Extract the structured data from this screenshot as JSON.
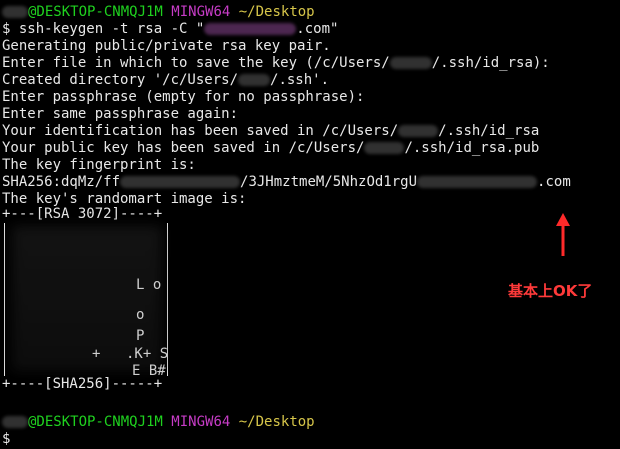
{
  "prompt": {
    "user_host": "@DESKTOP-CNMQJ1M",
    "shell": "MINGW64",
    "path": "~/Desktop"
  },
  "lines": {
    "cmd_pre": "$ ssh-keygen -t rsa -C \"",
    "cmd_post": ".com\"",
    "l2": "Generating public/private rsa key pair.",
    "l3_pre": "Enter file in which to save the key (/c/Users/",
    "l3_post": "/.ssh/id_rsa):",
    "l4_pre": "Created directory '/c/Users/",
    "l4_post": "/.ssh'.",
    "l5": "Enter passphrase (empty for no passphrase):",
    "l6": "Enter same passphrase again:",
    "l7_pre": "Your identification has been saved in /c/Users/",
    "l7_post": "/.ssh/id_rsa",
    "l8_pre": "Your public key has been saved in /c/Users/",
    "l8_post": "/.ssh/id_rsa.pub",
    "l9": "The key fingerprint is:",
    "l10_pre": "SHA256:dqMz/ff",
    "l10_mid": "/3JHmztmeM/5NhzOd1rgU",
    "l10_post": ".com",
    "l11": "The key's randomart image is:"
  },
  "randomart": {
    "top": "+---[RSA 3072]----+",
    "bottom": "+----[SHA256]-----+",
    "glyph_a": "L o",
    "glyph_b": "o",
    "glyph_c": "P",
    "glyph_d": "+",
    "glyph_e": ".K+ S",
    "glyph_f": "E B#"
  },
  "annotation": {
    "text": "基本上OK了",
    "color": "#ff3a3a"
  },
  "bottom_prompt": {
    "dollar": "$"
  }
}
